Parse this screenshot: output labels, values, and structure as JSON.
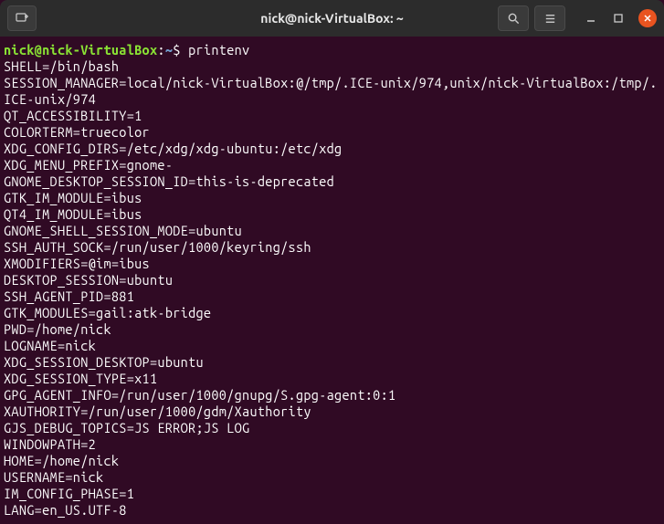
{
  "titlebar": {
    "title": "nick@nick-VirtualBox: ~"
  },
  "prompt": {
    "user_host": "nick@nick-VirtualBox",
    "colon": ":",
    "path": "~",
    "dollar": "$ ",
    "command": "printenv"
  },
  "output": [
    "SHELL=/bin/bash",
    "SESSION_MANAGER=local/nick-VirtualBox:@/tmp/.ICE-unix/974,unix/nick-VirtualBox:/tmp/.ICE-unix/974",
    "QT_ACCESSIBILITY=1",
    "COLORTERM=truecolor",
    "XDG_CONFIG_DIRS=/etc/xdg/xdg-ubuntu:/etc/xdg",
    "XDG_MENU_PREFIX=gnome-",
    "GNOME_DESKTOP_SESSION_ID=this-is-deprecated",
    "GTK_IM_MODULE=ibus",
    "QT4_IM_MODULE=ibus",
    "GNOME_SHELL_SESSION_MODE=ubuntu",
    "SSH_AUTH_SOCK=/run/user/1000/keyring/ssh",
    "XMODIFIERS=@im=ibus",
    "DESKTOP_SESSION=ubuntu",
    "SSH_AGENT_PID=881",
    "GTK_MODULES=gail:atk-bridge",
    "PWD=/home/nick",
    "LOGNAME=nick",
    "XDG_SESSION_DESKTOP=ubuntu",
    "XDG_SESSION_TYPE=x11",
    "GPG_AGENT_INFO=/run/user/1000/gnupg/S.gpg-agent:0:1",
    "XAUTHORITY=/run/user/1000/gdm/Xauthority",
    "GJS_DEBUG_TOPICS=JS ERROR;JS LOG",
    "WINDOWPATH=2",
    "HOME=/home/nick",
    "USERNAME=nick",
    "IM_CONFIG_PHASE=1",
    "LANG=en_US.UTF-8"
  ]
}
